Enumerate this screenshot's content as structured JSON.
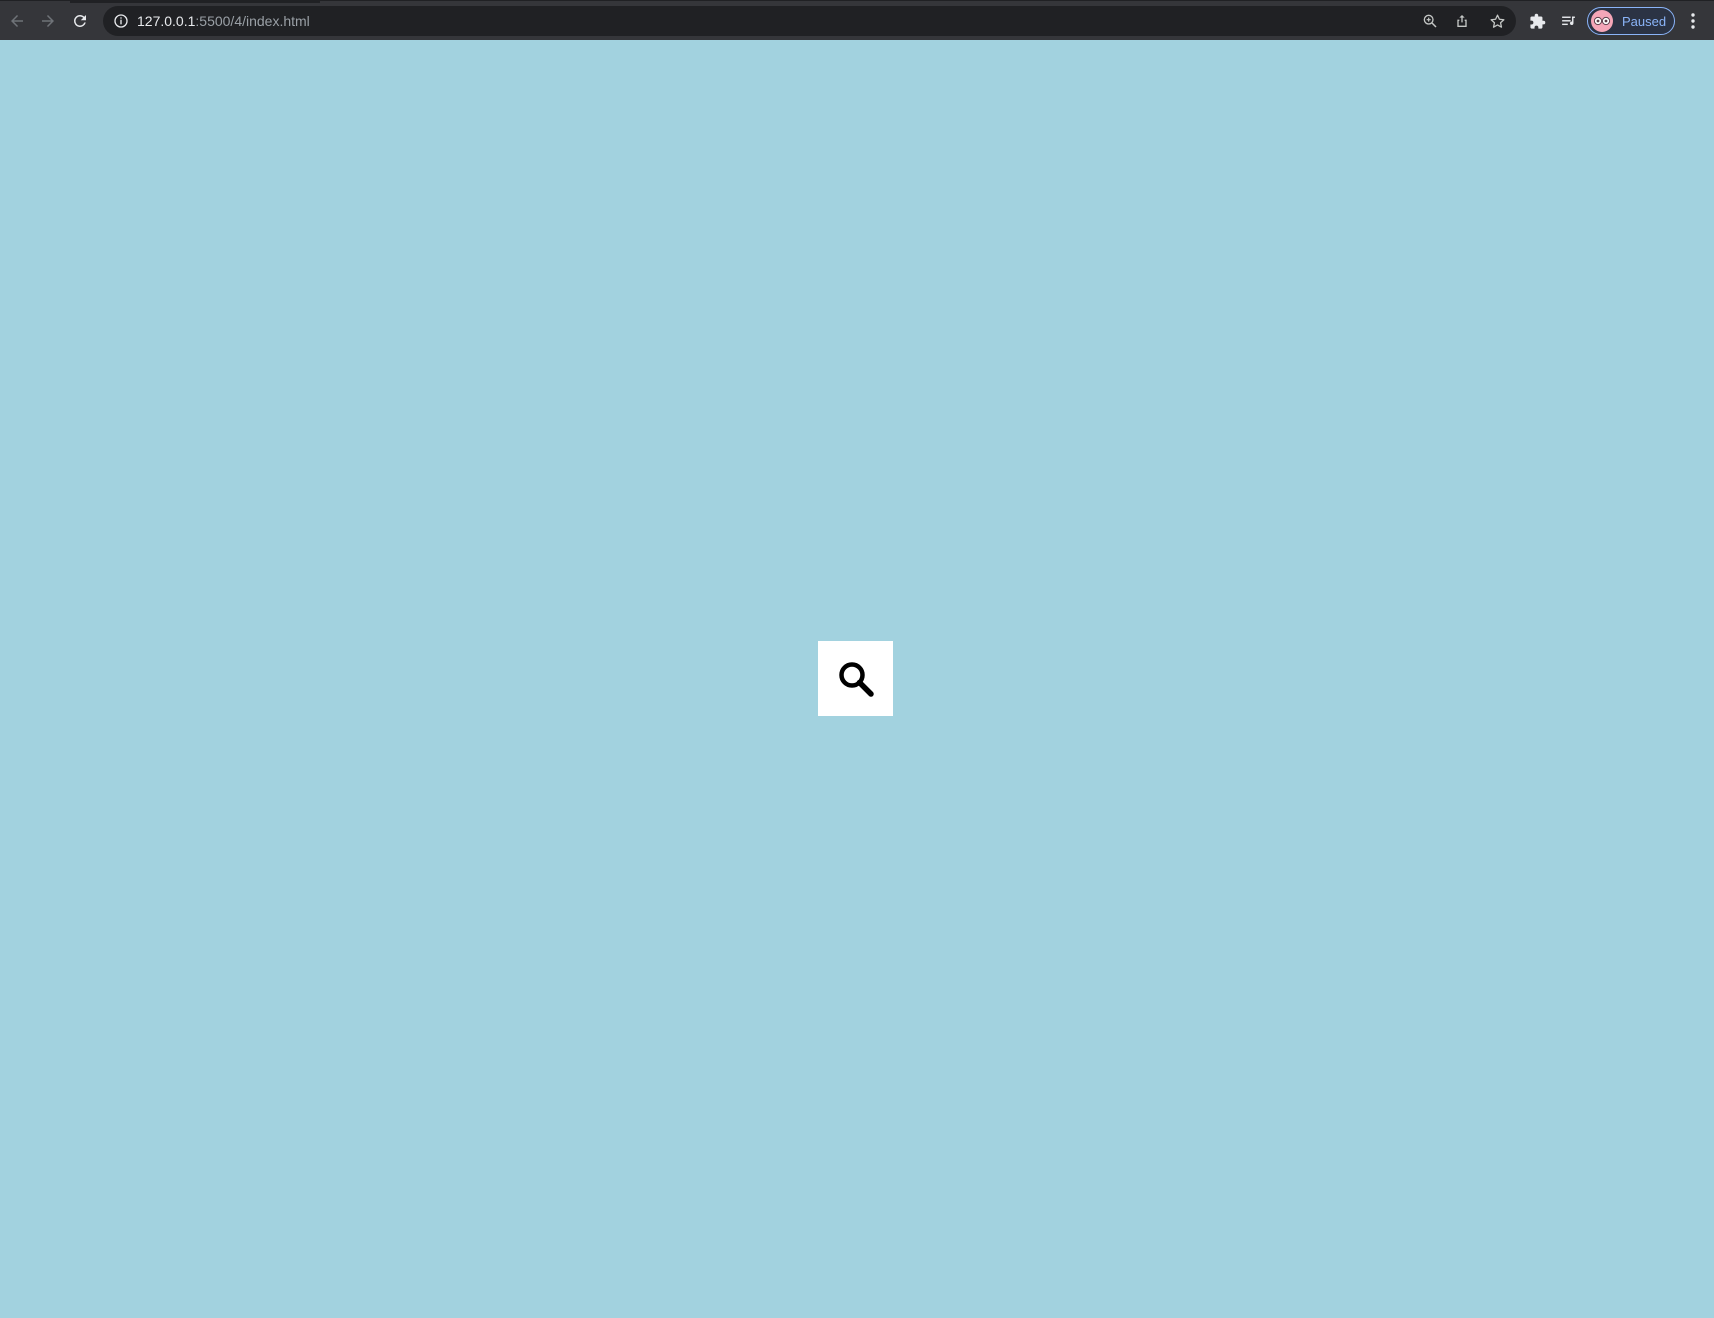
{
  "browser": {
    "url_host": "127.0.0.1",
    "url_rest": ":5500/4/index.html",
    "profile_status": "Paused",
    "icons": {
      "back": "arrow-left-icon",
      "forward": "arrow-right-icon",
      "reload": "reload-icon",
      "site_info": "info-icon",
      "zoom": "zoom-icon",
      "share": "share-icon",
      "bookmark": "star-icon",
      "extensions": "puzzle-icon",
      "reading_list": "reading-list-icon",
      "menu": "kebab-menu-icon"
    },
    "colors": {
      "toolbar": "#35363a",
      "omnibox": "#202124",
      "profile_accent": "#8ab4f8"
    }
  },
  "page": {
    "background": "#a2d2df",
    "search_widget": {
      "icon": "search-icon",
      "background": "#ffffff"
    }
  }
}
